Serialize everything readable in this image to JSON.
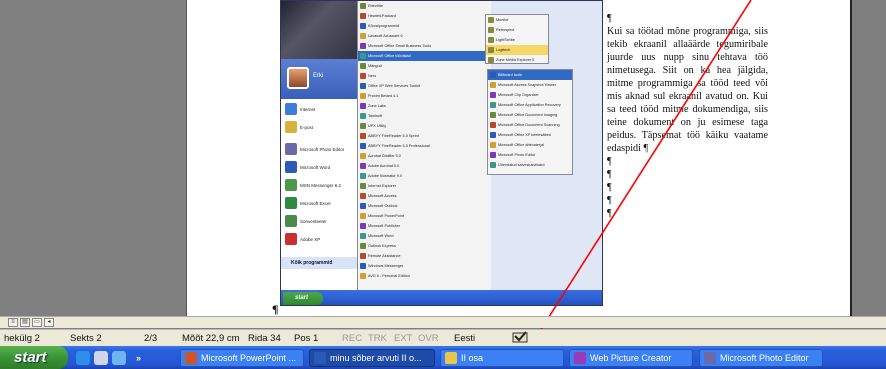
{
  "document": {
    "paragraph_mark": "¶",
    "text": "Kui sa töötad mõne programmiga, siis tekib ekraanil allaäärde tegumiribale juurde uus nupp sinu tehtava töö nimetusega. Siit on ka hea jälgida, mitme programmiga sa tööd teed või mis aknad sul ekraanil avatud on. Kui sa teed tööd mitme dokumendiga, siis teine dokument on ju esimese taga peidus. Täpsemat töö käiku vaatame edaspidi ¶",
    "empty_paragraphs": [
      "¶",
      "¶",
      "¶",
      "¶",
      "¶"
    ]
  },
  "embedded_screenshot": {
    "user_name": "Erki",
    "all_programs": "Kõik programmid",
    "start_label": "start",
    "pinned": [
      {
        "label": "Internet",
        "color": "#3b7dd8"
      },
      {
        "label": "E-post",
        "color": "#d8b23b"
      },
      {
        "label": "Microsoft Photo Editor",
        "color": "#6a6aa8"
      },
      {
        "label": "Microsoft Word",
        "color": "#2b5bb8"
      },
      {
        "label": "MSN Messenger 6.2",
        "color": "#4a9a4a"
      },
      {
        "label": "Microsoft Excel",
        "color": "#2e8a3e"
      },
      {
        "label": "Sonventeeter",
        "color": "#4a8a4a"
      },
      {
        "label": "Adobe XP",
        "color": "#c83030"
      }
    ],
    "programs": [
      "Ettevõtte",
      "Hewlett-Packard",
      "Kõrvalprogrammid",
      "Lavasoft Ad-aware 6",
      "Microsoft Office Small Business Tools",
      "Microsoft Office tööriistad",
      "Mängud",
      "Nero",
      "Office XP Web Services Toolkit",
      "Proxim Betard 4.1",
      "Zone Labs",
      "Tamlsoft",
      "UPX Utility",
      "ABBYY FineReader 5.0 Sprint",
      "ABBYY FineReader 6.0 Professional",
      "Acrobat Distiller 5.0",
      "Adobe Acrobat 5.0",
      "Adobe Illustrator 9.0",
      "Internet Explorer",
      "Microsoft Access",
      "Microsoft Outlook",
      "Microsoft PowerPoint",
      "Microsoft Publisher",
      "Microsoft Word",
      "Outlook Express",
      "Remote Assistance",
      "Windows Messenger",
      "AVG 6 - Personal Edition"
    ],
    "submenu_top": [
      "Monitor",
      "Retrospect",
      "LightScribe",
      "Logitech",
      "Zone Media Explorer 5"
    ],
    "submenu_office": [
      "Billboard tools",
      "Microsoft Access Snapshot Viewer",
      "Microsoft Clip Organizer",
      "Microsoft Office Application Recovery",
      "Microsoft Office Document Imaging",
      "Microsoft Office Document Scanning",
      "Microsoft Office XP keelesätted",
      "Microsoft Office abimaterjal",
      "Microsoft Photo Editor",
      "Ühendatud salvestusviisard"
    ]
  },
  "statusbar": {
    "lehekulg": "hekülg 2",
    "sektsioon": "Sekts 2",
    "pages": "2/3",
    "mood": "Mõõt 22,9 cm",
    "rida": "Rida 34",
    "pos": "Pos 1",
    "rec": "REC",
    "trk": "TRK",
    "ext": "EXT",
    "ovr": "OVR",
    "language": "Eesti",
    "spell_icon": "spellcheck-book-icon"
  },
  "taskbar": {
    "start": "start",
    "more": "»",
    "buttons": [
      {
        "label": "Microsoft PowerPoint ...",
        "icon_color": "#d0542a",
        "active": false
      },
      {
        "label": "minu sõber arvuti II o...",
        "icon_color": "#2b5bb8",
        "active": true
      },
      {
        "label": "II osa",
        "icon_color": "#e8c64a",
        "active": false
      },
      {
        "label": "Web Picture Creator",
        "icon_color": "#9a3ab8",
        "active": false
      },
      {
        "label": "Microsoft Photo Editor",
        "icon_color": "#6a6aa8",
        "active": false
      }
    ]
  },
  "colors": {
    "arrow": "#ff0000",
    "taskbar_blue": "#2456d6",
    "start_green": "#3a9435"
  }
}
